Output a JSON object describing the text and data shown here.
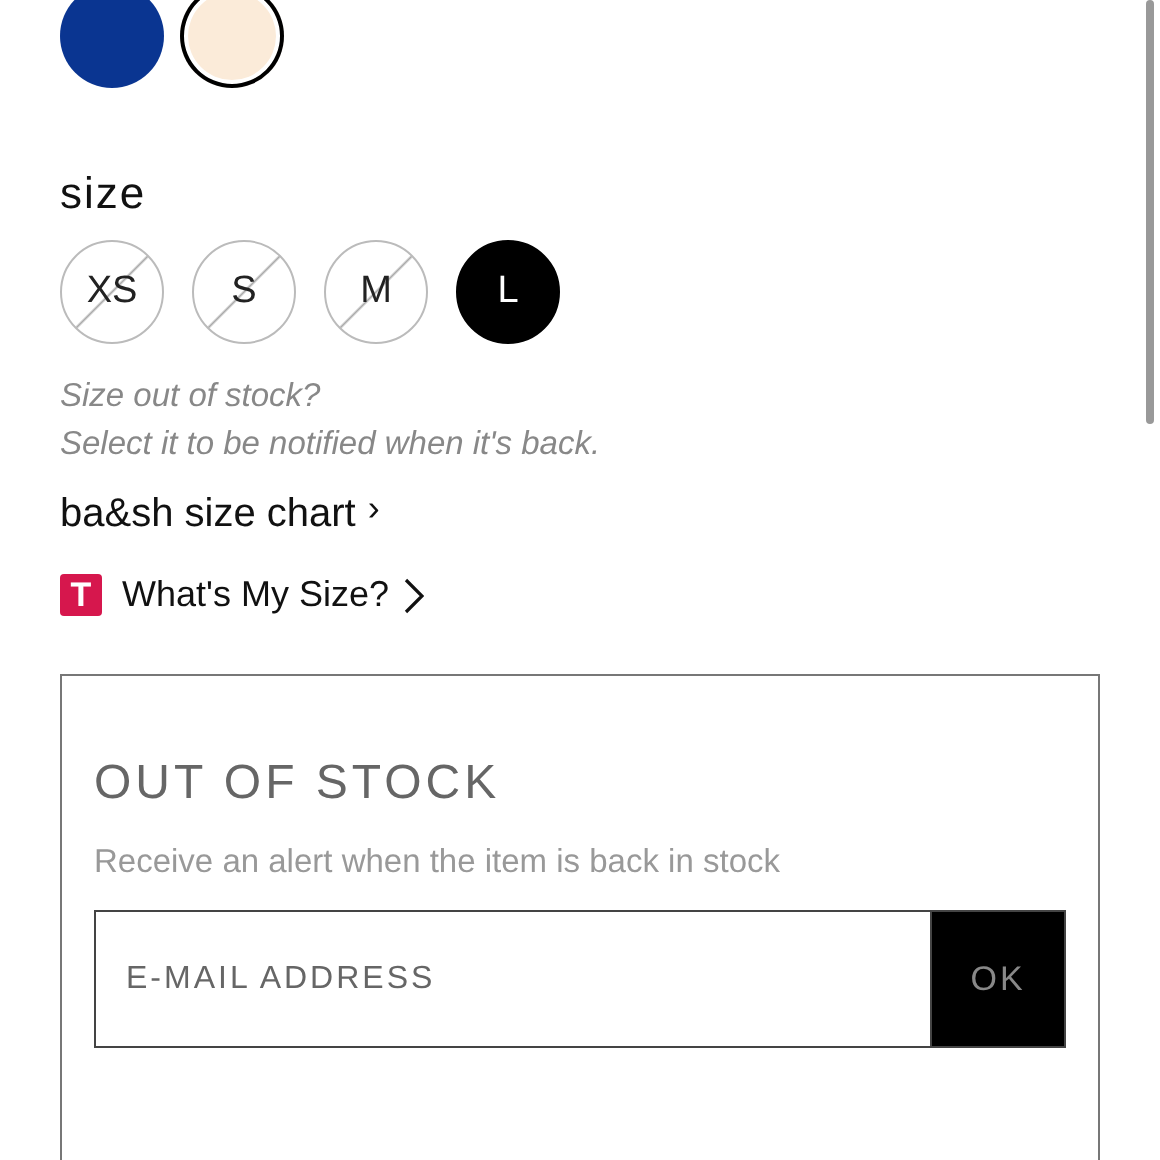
{
  "swatches": [
    {
      "color": "#0a3591",
      "selected": false
    },
    {
      "color": "#fbebd9",
      "selected": true
    }
  ],
  "size_label": "size",
  "sizes": [
    {
      "label": "XS",
      "out_of_stock": true,
      "selected": false
    },
    {
      "label": "S",
      "out_of_stock": true,
      "selected": false
    },
    {
      "label": "M",
      "out_of_stock": true,
      "selected": false
    },
    {
      "label": "L",
      "out_of_stock": false,
      "selected": true
    }
  ],
  "stock_note": [
    "Size out of stock?",
    "Select it to be notified when it's back."
  ],
  "size_chart_link": {
    "label": "ba&sh size chart",
    "icon": "›"
  },
  "fit_link": {
    "badge": "T",
    "label": "What's My Size?"
  },
  "alert_box": {
    "title": "OUT OF STOCK",
    "text": "Receive an alert when the item is back in stock",
    "email": {
      "placeholder": "E-MAIL ADDRESS"
    },
    "button": "OK"
  }
}
